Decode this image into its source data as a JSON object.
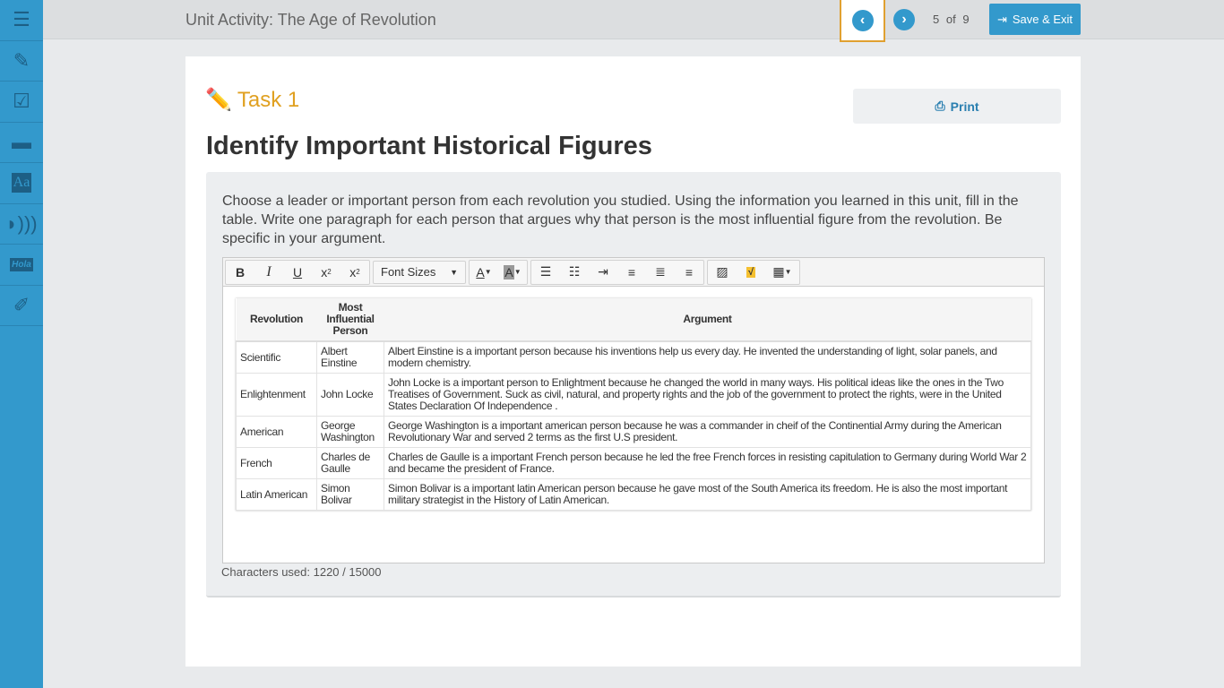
{
  "sidebar": {
    "items": [
      {
        "icon": "list-icon"
      },
      {
        "icon": "edit-notes-icon"
      },
      {
        "icon": "checklist-icon"
      },
      {
        "icon": "folder-icon"
      },
      {
        "icon": "dictionary-icon"
      },
      {
        "icon": "speech-icon"
      },
      {
        "icon": "translate-icon",
        "text": "Hola"
      },
      {
        "icon": "highlighter-icon"
      }
    ]
  },
  "header": {
    "title": "Unit Activity: The Age of Revolution",
    "page_current": "5",
    "page_of": "of",
    "page_total": "9",
    "save_label": "Save & Exit"
  },
  "task": {
    "label": "Task 1",
    "print_label": "Print",
    "heading": "Identify Important Historical Figures",
    "prompt": "Choose a leader or important person from each revolution you studied. Using the information you learned in this unit, fill in the table. Write one paragraph for each person that argues why that person is the most influential figure from the revolution. Be specific in your argument."
  },
  "editor": {
    "font_sizes": "Font Sizes",
    "characters_used": "Characters used: 1220 / 15000"
  },
  "table": {
    "headers": [
      "Revolution",
      "Most Influential Person",
      "Argument"
    ],
    "rows": [
      [
        "Scientific",
        "Albert Einstine",
        "Albert Einstine is a important person because his inventions help us every day. He invented the understanding of light, solar panels, and modern chemistry."
      ],
      [
        "Enlightenment",
        "John Locke",
        "John Locke is a important person to Enlightment because he changed the world in many ways. His political ideas like the ones in the Two Treatises of Government. Suck as civil, natural, and property rights and the job of the government to protect the rights, were in the United States Declaration Of Independence ."
      ],
      [
        "American",
        "George Washington",
        "George Washington is a important american person because he was a commander in cheif of the Continential Army during the American Revolutionary War and served 2 terms as the first U.S president."
      ],
      [
        "French",
        "Charles de Gaulle",
        "Charles de Gaulle is a important French person because he led the free French forces in resisting capitulation to Germany during World War 2 and became the president of France."
      ],
      [
        "Latin American",
        "Simon Bolivar",
        "Simon Bolivar is a important latin American person because he gave most of the South America its freedom. He is also the most important military strategist in the History of Latin American."
      ]
    ]
  },
  "colors": {
    "accent": "#3399cc",
    "task": "#e0a020",
    "focus": "#e0a030"
  }
}
